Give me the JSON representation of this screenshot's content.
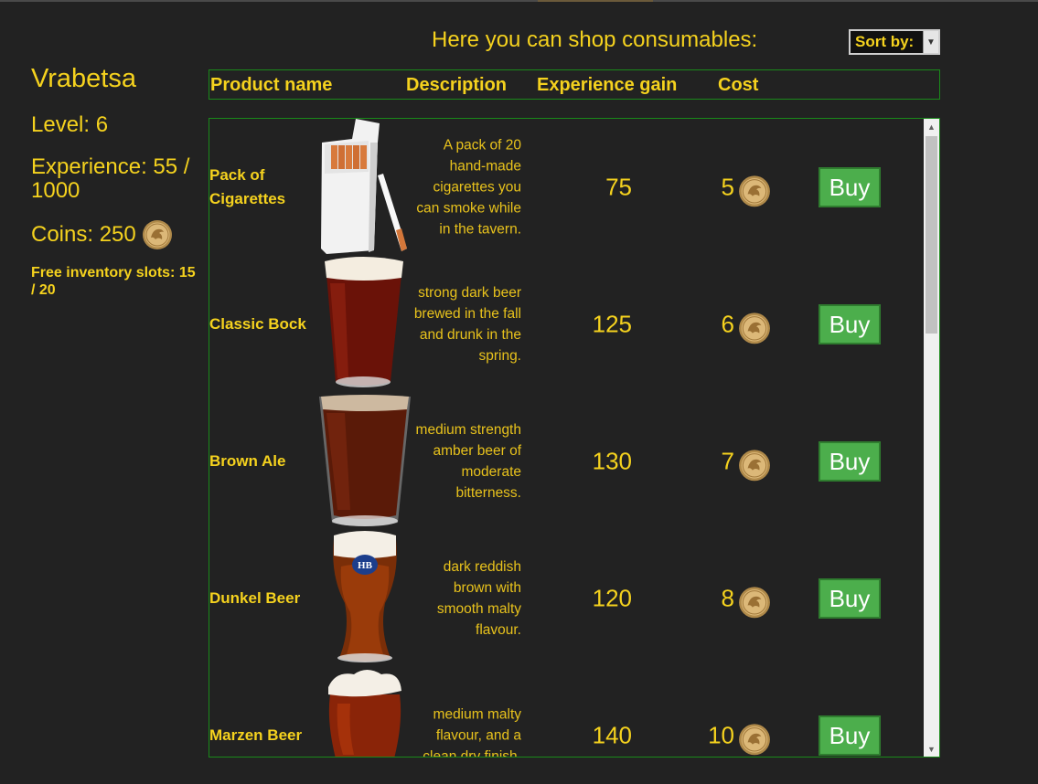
{
  "player": {
    "name": "Vrabetsa",
    "level": "Level: 6",
    "experience": "Experience: 55 / 1000",
    "coins": "Coins: 250",
    "slots": "Free inventory slots: 15 / 20"
  },
  "shop": {
    "heading": "Here you can shop consumables:",
    "sort_label": "Sort by:",
    "columns": [
      "Product name",
      "Description",
      "Experience gain",
      "Cost"
    ]
  },
  "products": [
    {
      "name": "Pack of Cigarettes",
      "description": "A pack of 20 hand-made cigarettes you can smoke while in the tavern.",
      "experience": "75",
      "cost": "5",
      "buy_label": "Buy",
      "image_icon": "cigarette-pack-icon"
    },
    {
      "name": "Classic Bock",
      "description": "strong dark beer brewed in the fall and drunk in the spring.",
      "experience": "125",
      "cost": "6",
      "buy_label": "Buy",
      "image_icon": "dark-beer-pint-icon"
    },
    {
      "name": "Brown Ale",
      "description": "medium strength amber beer of moderate bitterness.",
      "experience": "130",
      "cost": "7",
      "buy_label": "Buy",
      "image_icon": "brown-ale-glass-icon"
    },
    {
      "name": "Dunkel Beer",
      "description": "dark reddish brown with smooth malty flavour.",
      "experience": "120",
      "cost": "8",
      "buy_label": "Buy",
      "image_icon": "dunkel-beer-glass-icon"
    },
    {
      "name": "Marzen Beer",
      "description": "medium malty flavour, and a clean dry finish.",
      "experience": "140",
      "cost": "10",
      "buy_label": "Buy",
      "image_icon": "marzen-beer-glass-icon"
    }
  ],
  "colors": {
    "background": "#222222",
    "text": "#f5d21e",
    "border": "#1a8a1a",
    "buy_button": "#4cae4c"
  }
}
